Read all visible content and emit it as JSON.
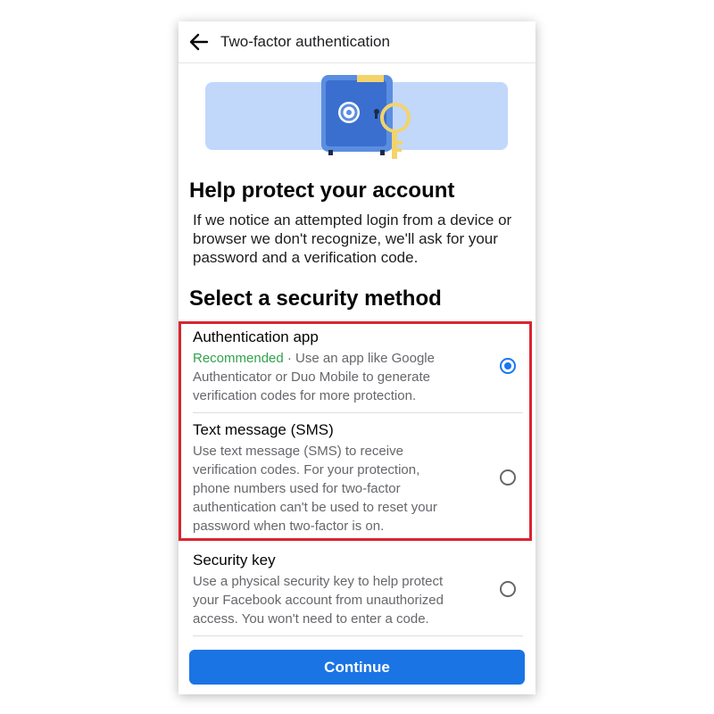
{
  "header": {
    "back_icon": "arrow-left-icon",
    "title": "Two-factor authentication"
  },
  "hero": {
    "icon": "safe-with-key-illustration"
  },
  "intro": {
    "heading": "Help protect your account",
    "text": "If we notice an attempted login from a device or browser we don't recognize, we'll ask for your password and a verification code."
  },
  "methods": {
    "heading": "Select a security method",
    "options": [
      {
        "title": "Authentication app",
        "badge": "Recommended",
        "text": " · Use an app like Google Authenticator or Duo Mobile to generate verification codes for more protection.",
        "selected": true
      },
      {
        "title": "Text message (SMS)",
        "text": "Use text message (SMS) to receive verification codes. For your protection, phone numbers used for two-factor authentication can't be used to reset your password when two-factor is on.",
        "selected": false
      },
      {
        "title": "Security key",
        "text": "Use a physical security key to help protect your Facebook account from unauthorized access. You won't need to enter a code.",
        "selected": false
      }
    ]
  },
  "continue_label": "Continue",
  "colors": {
    "primary": "#1b74e4",
    "recommended": "#31a24c",
    "highlight_border": "#d9252f",
    "hero_band": "#c1d8fb"
  }
}
